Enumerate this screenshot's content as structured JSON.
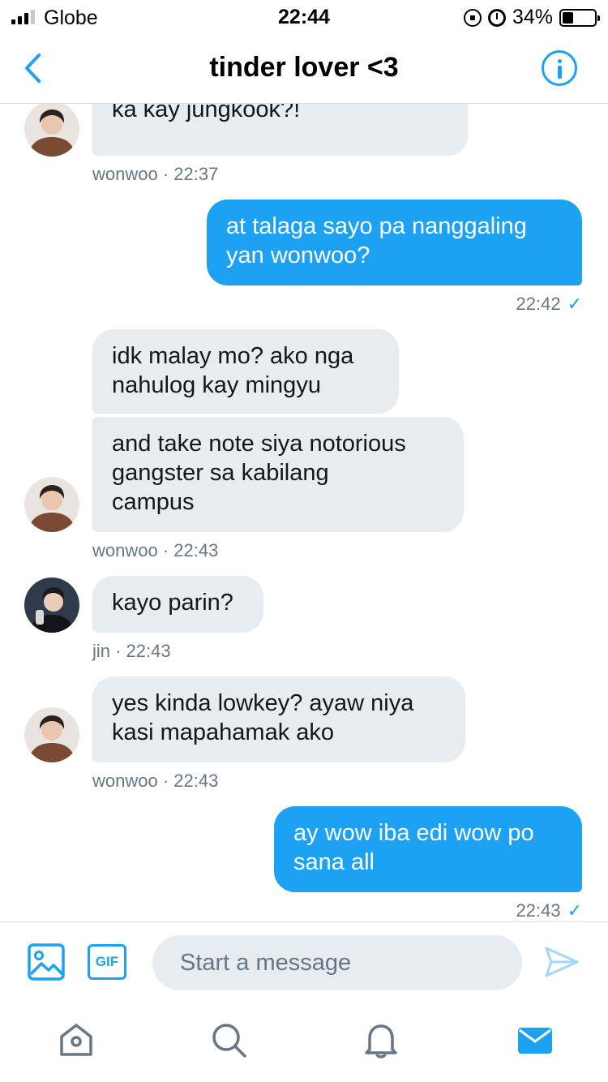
{
  "status_bar": {
    "carrier": "Globe",
    "time": "22:44",
    "battery": "34%",
    "battery_level": 0.34
  },
  "header": {
    "title": "tinder lover <3"
  },
  "messages": {
    "m1": {
      "text": "wag mong sabihin natamaan\nka kay jungkook?!",
      "meta": "wonwoo · 22:37"
    },
    "m2": {
      "text": "at talaga sayo pa nanggaling\nyan wonwoo?",
      "meta": "22:42"
    },
    "m3": {
      "text": "idk malay mo? ako nga\nnahulog kay mingyu"
    },
    "m4": {
      "text": "and take note siya notorious\ngangster sa kabilang\ncampus",
      "meta": "wonwoo · 22:43"
    },
    "m5": {
      "text": "kayo parin?",
      "meta": "jin · 22:43"
    },
    "m6": {
      "text": "yes kinda lowkey? ayaw niya\nkasi mapahamak ako",
      "meta": "wonwoo · 22:43"
    },
    "m7": {
      "text": "ay wow iba edi wow po\nsana all",
      "meta": "22:43"
    }
  },
  "read_tick": "✓",
  "composer": {
    "placeholder": "Start a message",
    "gif_label": "GIF"
  },
  "colors": {
    "accent": "#1da1f2",
    "incoming_bubble": "#e6ecf0",
    "meta_text": "#657786"
  },
  "icons": [
    "back-chevron-icon",
    "info-icon",
    "image-icon",
    "gif-icon",
    "send-icon",
    "home-icon",
    "search-icon",
    "notifications-icon",
    "messages-icon"
  ]
}
